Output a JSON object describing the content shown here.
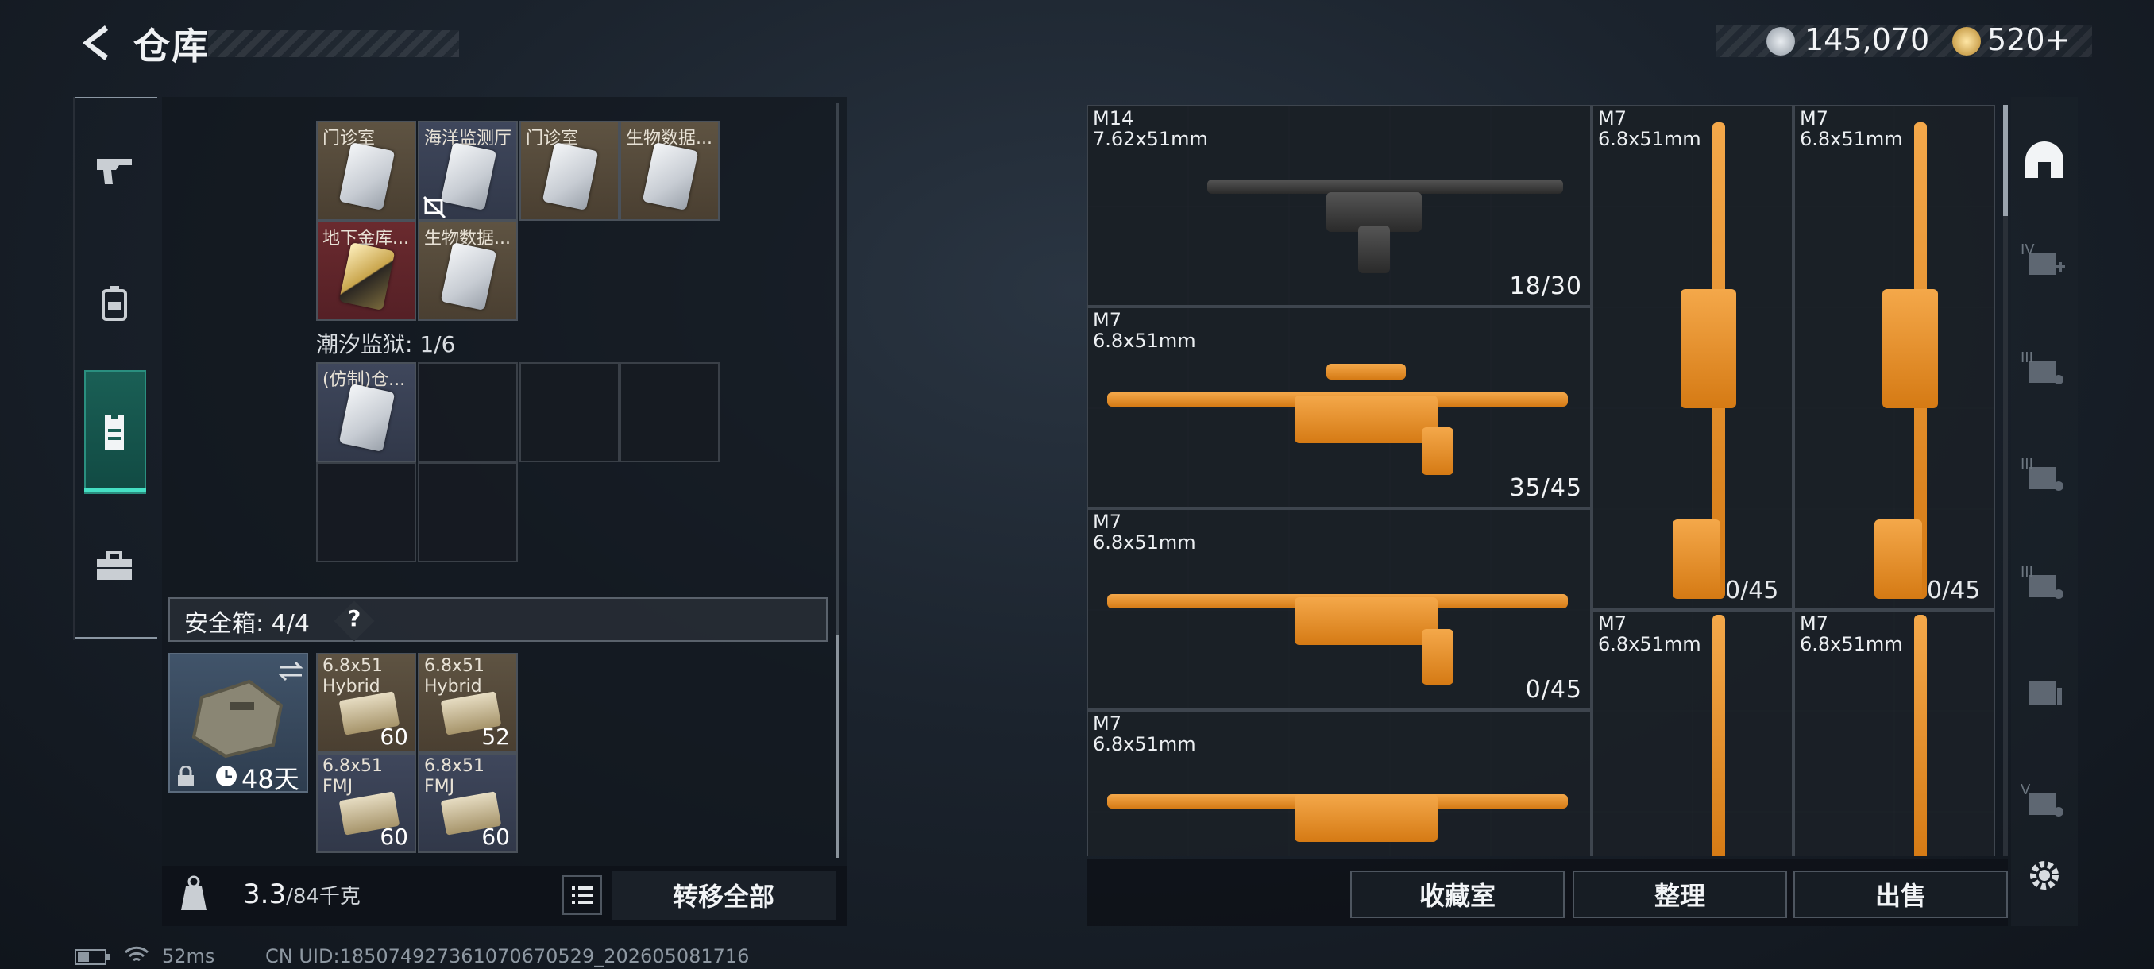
{
  "header": {
    "title": "仓库",
    "silver": "145,070",
    "gold": "520+"
  },
  "left_rail": {
    "items": [
      "weapons",
      "backpack",
      "armor",
      "toolbox"
    ],
    "active_index": 2
  },
  "containers": {
    "top_cells": [
      "门诊室",
      "海洋监测厅",
      "门诊室",
      "生物数据...",
      "地下金库...",
      "生物数据..."
    ],
    "tide_label": "潮汐监狱: 1/6",
    "tide_cells": [
      "(仿制)仓..."
    ]
  },
  "safe_box": {
    "label": "安全箱: 4/4",
    "help": "?",
    "duration": "48天",
    "ammo": [
      {
        "name1": "6.8x51",
        "name2": "Hybrid",
        "count": "60"
      },
      {
        "name1": "6.8x51",
        "name2": "Hybrid",
        "count": "52"
      },
      {
        "name1": "6.8x51",
        "name2": "FMJ",
        "count": "60"
      },
      {
        "name1": "6.8x51",
        "name2": "FMJ",
        "count": "60"
      }
    ]
  },
  "footer_left": {
    "weight_value": "3.3",
    "weight_max": "/84千克",
    "transfer_all": "转移全部"
  },
  "weapons": [
    {
      "name": "M14",
      "caliber": "7.62x51mm",
      "ammo": "18/30"
    },
    {
      "name": "M7",
      "caliber": "6.8x51mm",
      "ammo": ""
    },
    {
      "name": "M7",
      "caliber": "6.8x51mm",
      "ammo": ""
    },
    {
      "name": "M7",
      "caliber": "6.8x51mm",
      "ammo": "35/45"
    },
    {
      "name": "M7",
      "caliber": "6.8x51mm",
      "ammo": "0/45"
    },
    {
      "name": "M7",
      "caliber": "6.8x51mm",
      "ammo": "0/45"
    },
    {
      "name": "M7",
      "caliber": "6.8x51mm",
      "ammo": "0/45"
    },
    {
      "name": "M7",
      "caliber": "6.8x51mm",
      "ammo": ""
    },
    {
      "name": "M7",
      "caliber": "6.8x51mm",
      "ammo": ""
    },
    {
      "name": "M7",
      "caliber": "6.8x51mm",
      "ammo": ""
    }
  ],
  "right_rail": {
    "tiers": [
      "IV",
      "III",
      "III",
      "III",
      "",
      "V"
    ]
  },
  "bottom_buttons": {
    "collection": "收藏室",
    "organize": "整理",
    "sell": "出售"
  },
  "status": {
    "ping": "52ms",
    "uid": "CN UID:1850749273610706705​29_202605081716"
  },
  "colors": {
    "accent_teal": "#46e0c4",
    "weapon_orange": "#e8922a"
  }
}
